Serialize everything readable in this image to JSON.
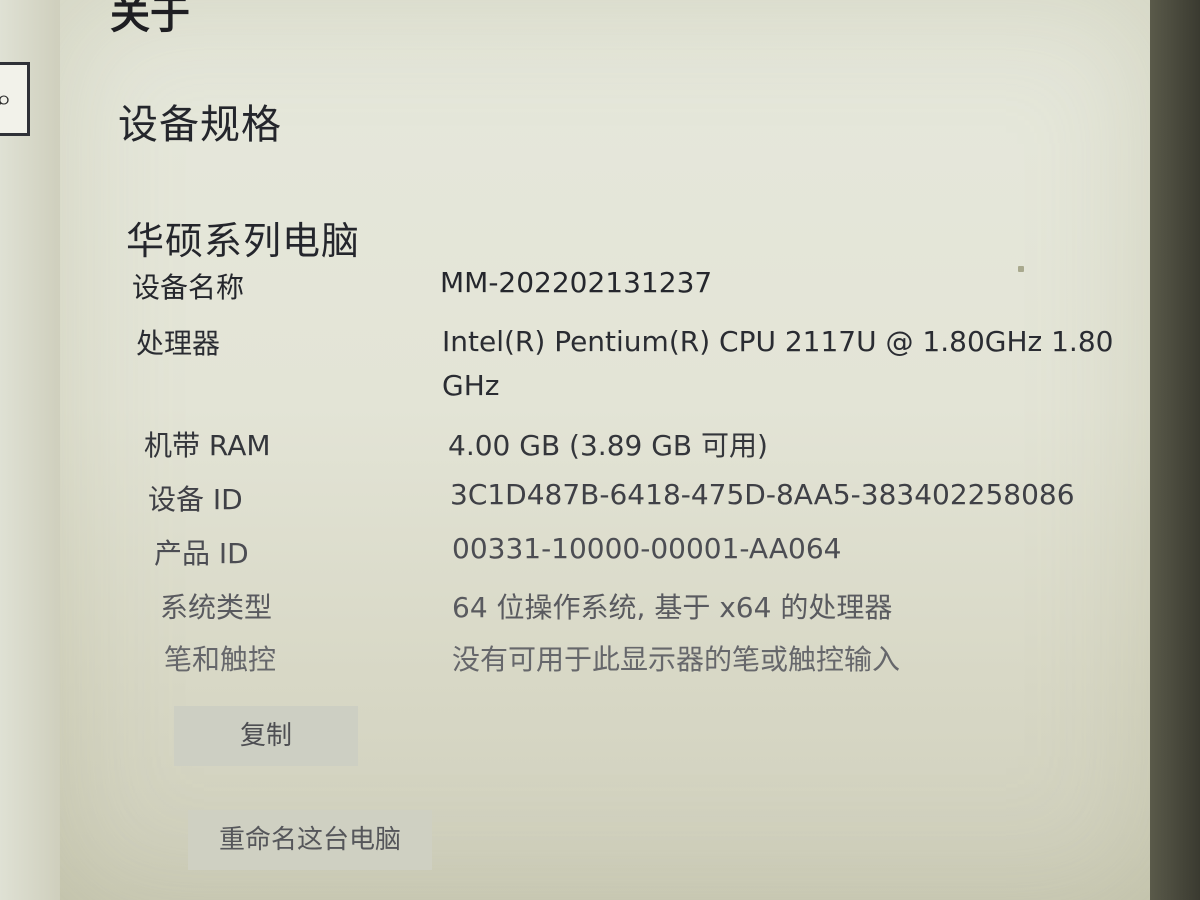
{
  "page": {
    "top_cutoff_text": "关于",
    "section_title": "设备规格",
    "device_heading": "华硕系列电脑"
  },
  "specs": [
    {
      "label": "设备名称",
      "value": "MM-202202131237"
    },
    {
      "label": "处理器",
      "value": "Intel(R) Pentium(R) CPU 2117U @ 1.80GHz   1.80 GHz"
    },
    {
      "label": "机带 RAM",
      "value": "4.00 GB (3.89 GB 可用)"
    },
    {
      "label": "设备 ID",
      "value": "3C1D487B-6418-475D-8AA5-383402258086"
    },
    {
      "label": "产品 ID",
      "value": "00331-10000-00001-AA064"
    },
    {
      "label": "系统类型",
      "value": "64 位操作系统, 基于 x64 的处理器"
    },
    {
      "label": "笔和触控",
      "value": "没有可用于此显示器的笔或触控输入"
    }
  ],
  "buttons": {
    "copy": "复制",
    "rename": "重命名这台电脑"
  },
  "icons": {
    "search": "search-icon"
  }
}
